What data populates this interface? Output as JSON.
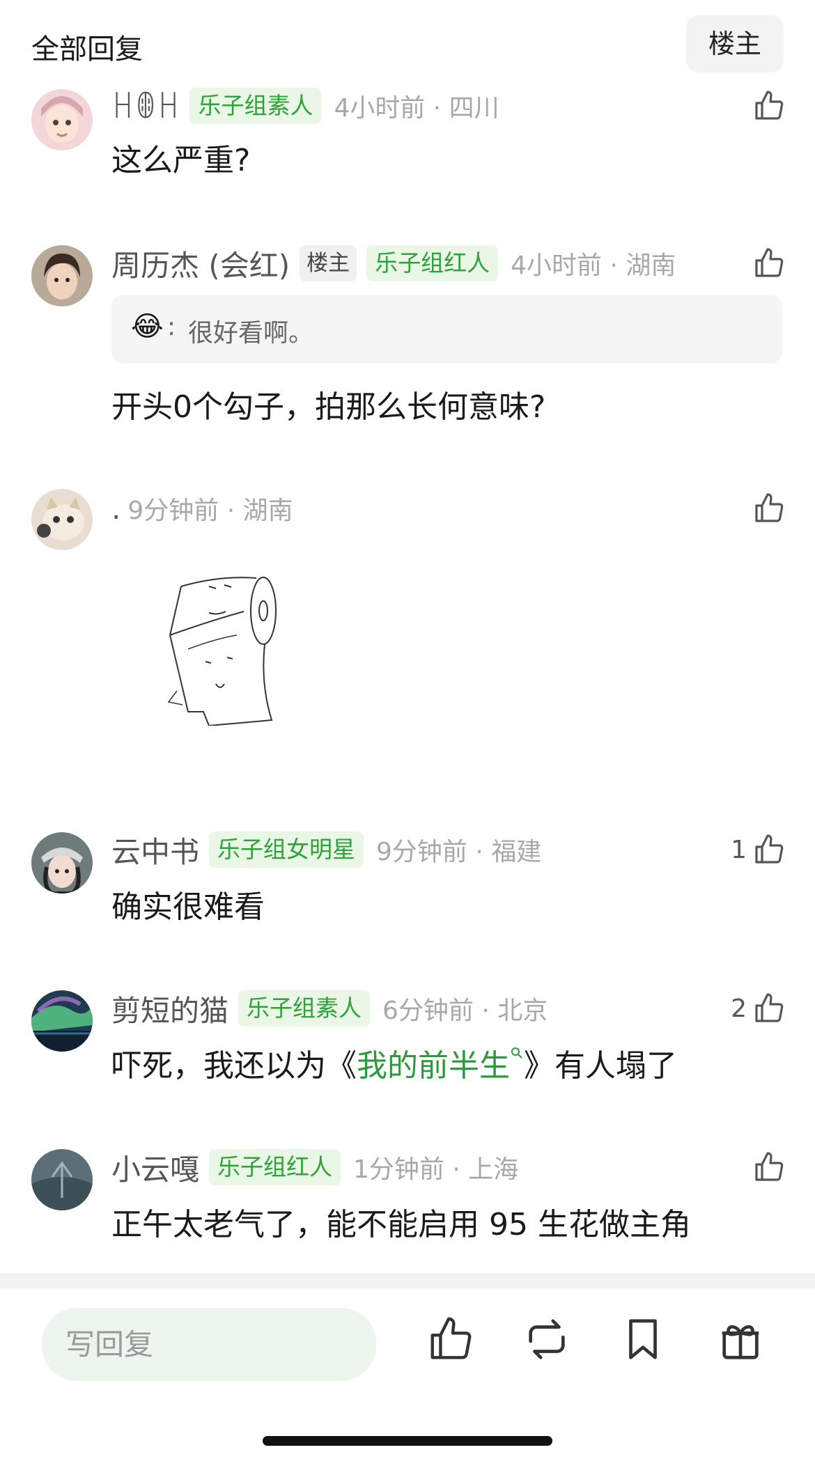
{
  "header": {
    "title": "全部回复",
    "owner_button": "楼主"
  },
  "comments": [
    {
      "username": "ꀿꂦꀿ",
      "badges": [
        "乐子组素人"
      ],
      "time": "4小时前 · 四川",
      "like_count": "",
      "text": "这么严重?"
    },
    {
      "username": "周历杰 (会红)",
      "owner_tag": "楼主",
      "badges": [
        "乐子组红人"
      ],
      "time": "4小时前 · 湖南",
      "like_count": "",
      "quote": {
        "emoji": "😂",
        "text": "很好看啊。"
      },
      "text": "开头0个勾子，拍那么长何意味?"
    },
    {
      "username": ".",
      "badges": [],
      "time": "9分钟前 · 湖南",
      "like_count": "",
      "image": "toilet-paper-meme-sticker"
    },
    {
      "username": "云中书",
      "badges": [
        "乐子组女明星"
      ],
      "time": "9分钟前 · 福建",
      "like_count": "1",
      "text": "确实很难看"
    },
    {
      "username": "剪短的猫",
      "badges": [
        "乐子组素人"
      ],
      "time": "6分钟前 · 北京",
      "like_count": "2",
      "text_before": "吓死，我还以为《",
      "link_text": "我的前半生",
      "text_after": "》有人塌了"
    },
    {
      "username": "小云嘎",
      "badges": [
        "乐子组红人"
      ],
      "time": "1分钟前 · 上海",
      "like_count": "",
      "text": "正午太老气了，能不能启用 95 生花做主角"
    }
  ],
  "bottom_bar": {
    "reply_placeholder": "写回复",
    "icons": [
      "thumbs-up-icon",
      "repost-icon",
      "bookmark-icon",
      "gift-icon"
    ]
  },
  "colors": {
    "accent_green": "#2fa23b",
    "badge_bg": "#eaf7e6",
    "meta_gray": "#a8a8a8"
  }
}
